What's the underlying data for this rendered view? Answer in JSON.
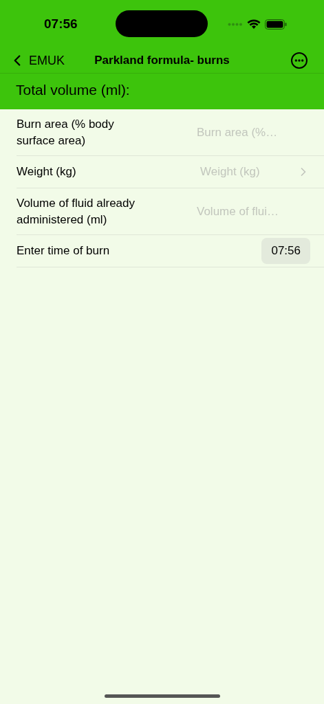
{
  "status_bar": {
    "time": "07:56"
  },
  "nav": {
    "back_label": "EMUK",
    "title": "Parkland formula- burns"
  },
  "result": {
    "label": "Total volume (ml):"
  },
  "rows": [
    {
      "kind": "text",
      "label": "Burn area (% body surface area)",
      "placeholder": "Burn area (%…"
    },
    {
      "kind": "picker",
      "label": "Weight (kg)",
      "placeholder": "Weight (kg)"
    },
    {
      "kind": "text",
      "label": "Volume of fluid already administered (ml)",
      "placeholder": "Volume of flui…"
    },
    {
      "kind": "time",
      "label": "Enter time of burn",
      "value": "07:56"
    }
  ]
}
